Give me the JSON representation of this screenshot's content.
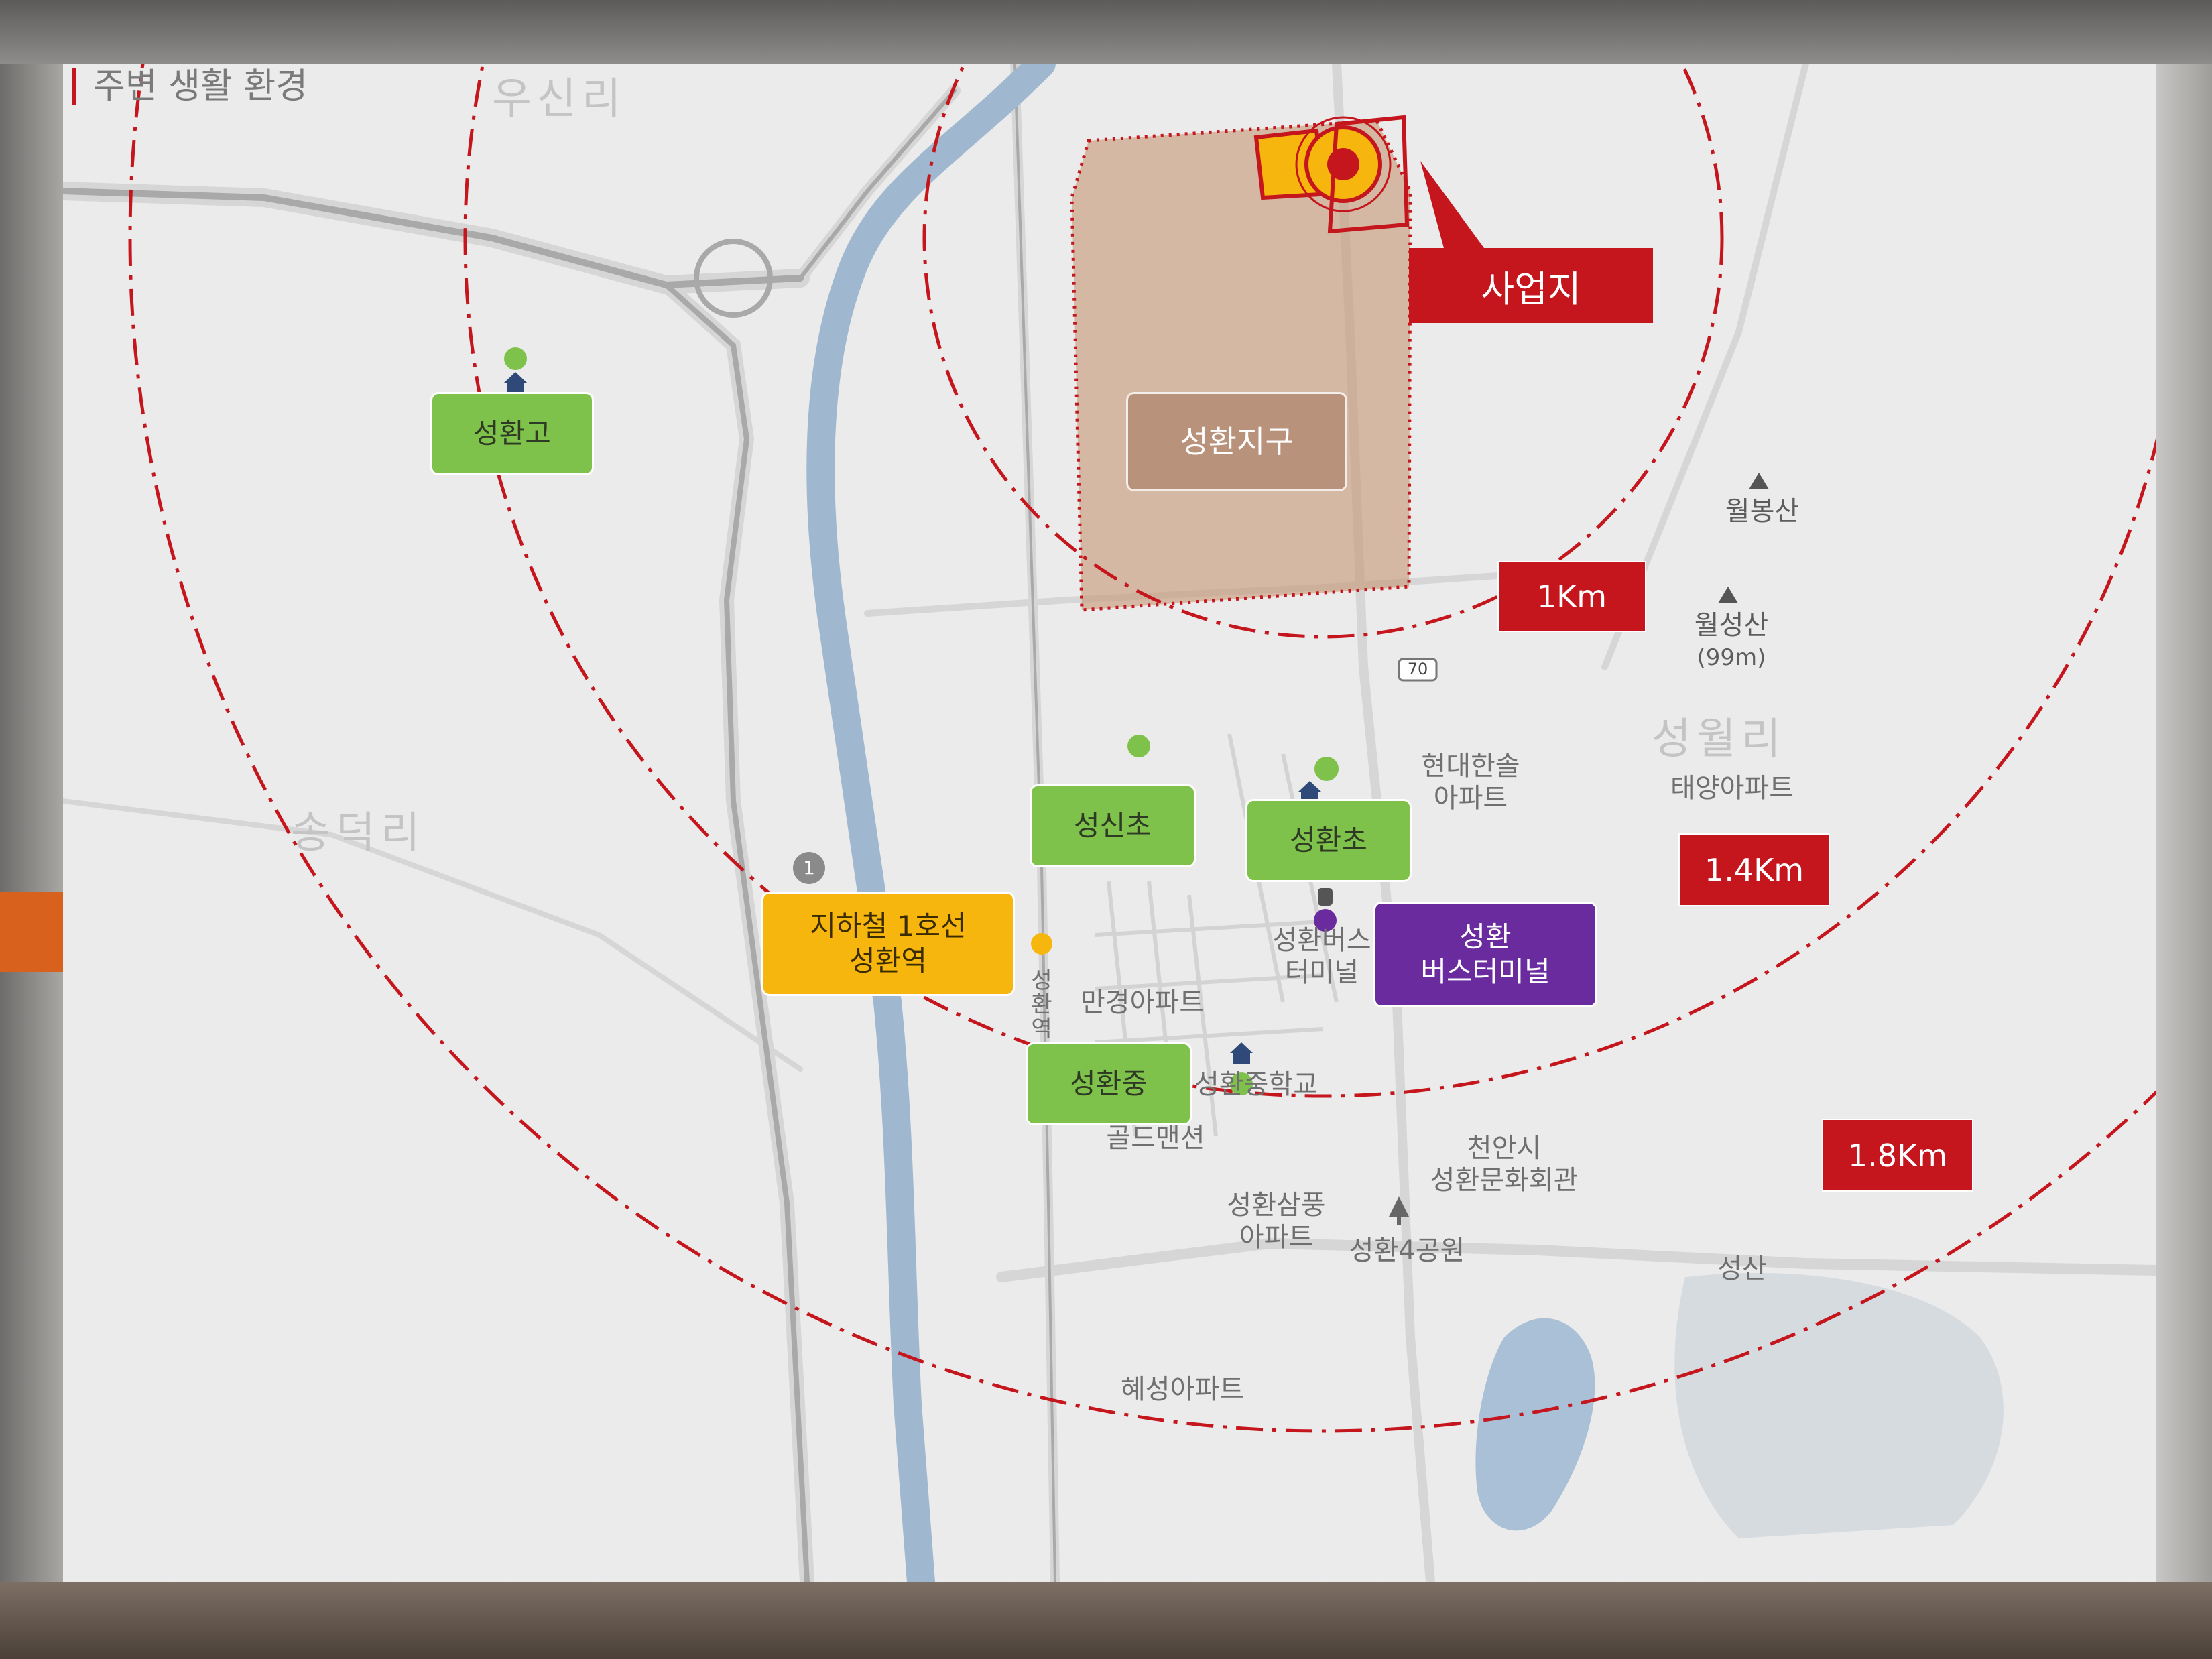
{
  "heading": "주변 생활 환경",
  "site": {
    "label": "사업지"
  },
  "district": {
    "label": "성환지구"
  },
  "radii": [
    {
      "label": "1Km"
    },
    {
      "label": "1.4Km"
    },
    {
      "label": "1.8Km"
    }
  ],
  "facilities": {
    "high_school": "성환고",
    "elem_seongsin": "성신초",
    "elem_seonghwan": "성환초",
    "middle_school": "성환중",
    "subway_line": "지하철 1호선",
    "subway_station": "성환역",
    "bus_line1": "성환",
    "bus_line2": "버스터미널"
  },
  "map_places": {
    "village_usin": "우신리",
    "village_songdeok": "송덕리",
    "village_seongwol": "성월리",
    "mountain_wolbong": "월봉산",
    "mountain_wolseong": "월성산",
    "mountain_wolseong_height": "(99m)",
    "apt_hyundai_1": "현대한솔",
    "apt_hyundai_2": "아파트",
    "apt_taeyang": "태양아파트",
    "bus_terminal_1": "성환버스",
    "bus_terminal_2": "터미널",
    "apt_mangyeong": "만경아파트",
    "school_map": "성환중학교",
    "goldmansion": "골드맨션",
    "cultural_1": "천안시",
    "cultural_2": "성환문화회관",
    "apt_samsung_1": "성환삼풍",
    "apt_samsung_2": "아파트",
    "park": "성환4공원",
    "seongsan": "성산",
    "apt_hyeseong": "혜성아파트",
    "road_route": "70",
    "road_1": "1",
    "station_vertical": "성환역"
  },
  "colors": {
    "accent_red": "#c4161c",
    "green": "#7fc24b",
    "yellow": "#f7b60e",
    "purple": "#6a2b9e",
    "district": "#b8927a",
    "river": "#9fb8d0"
  },
  "icons": [
    "site-target-icon",
    "pointer-triangle-icon",
    "school-icon",
    "peak-icon",
    "bus-icon",
    "park-icon"
  ]
}
